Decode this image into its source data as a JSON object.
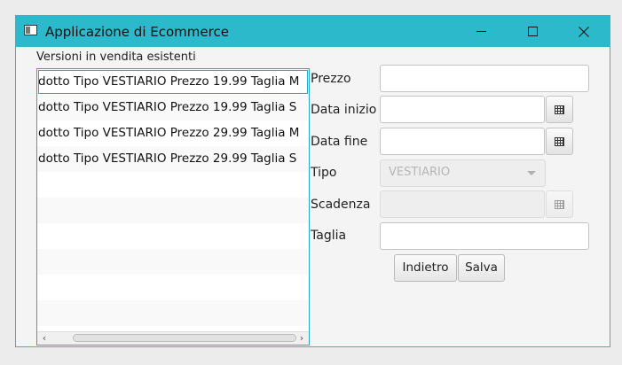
{
  "window": {
    "title": "Applicazione di Ecommerce"
  },
  "list": {
    "title": "Versioni in vendita esistenti",
    "items": [
      "dotto Tipo VESTIARIO Prezzo 19.99 Taglia M",
      "dotto Tipo VESTIARIO Prezzo 19.99 Taglia S",
      "dotto Tipo VESTIARIO Prezzo 29.99 Taglia M",
      "dotto Tipo VESTIARIO Prezzo 29.99 Taglia S"
    ],
    "selected_index": 0
  },
  "form": {
    "prezzo_label": "Prezzo",
    "prezzo_value": "",
    "data_inizio_label": "Data inizio",
    "data_inizio_value": "",
    "data_fine_label": "Data fine",
    "data_fine_value": "",
    "tipo_label": "Tipo",
    "tipo_value": "VESTIARIO",
    "scadenza_label": "Scadenza",
    "scadenza_value": "",
    "taglia_label": "Taglia",
    "taglia_value": ""
  },
  "buttons": {
    "back_label": "Indietro",
    "save_label": "Salva"
  },
  "icons": {
    "calendar": "calendar-icon",
    "dropdown": "chevron-down-icon"
  },
  "colors": {
    "titlebar": "#2cb9cc",
    "focus_border": "#2aa7c6"
  }
}
